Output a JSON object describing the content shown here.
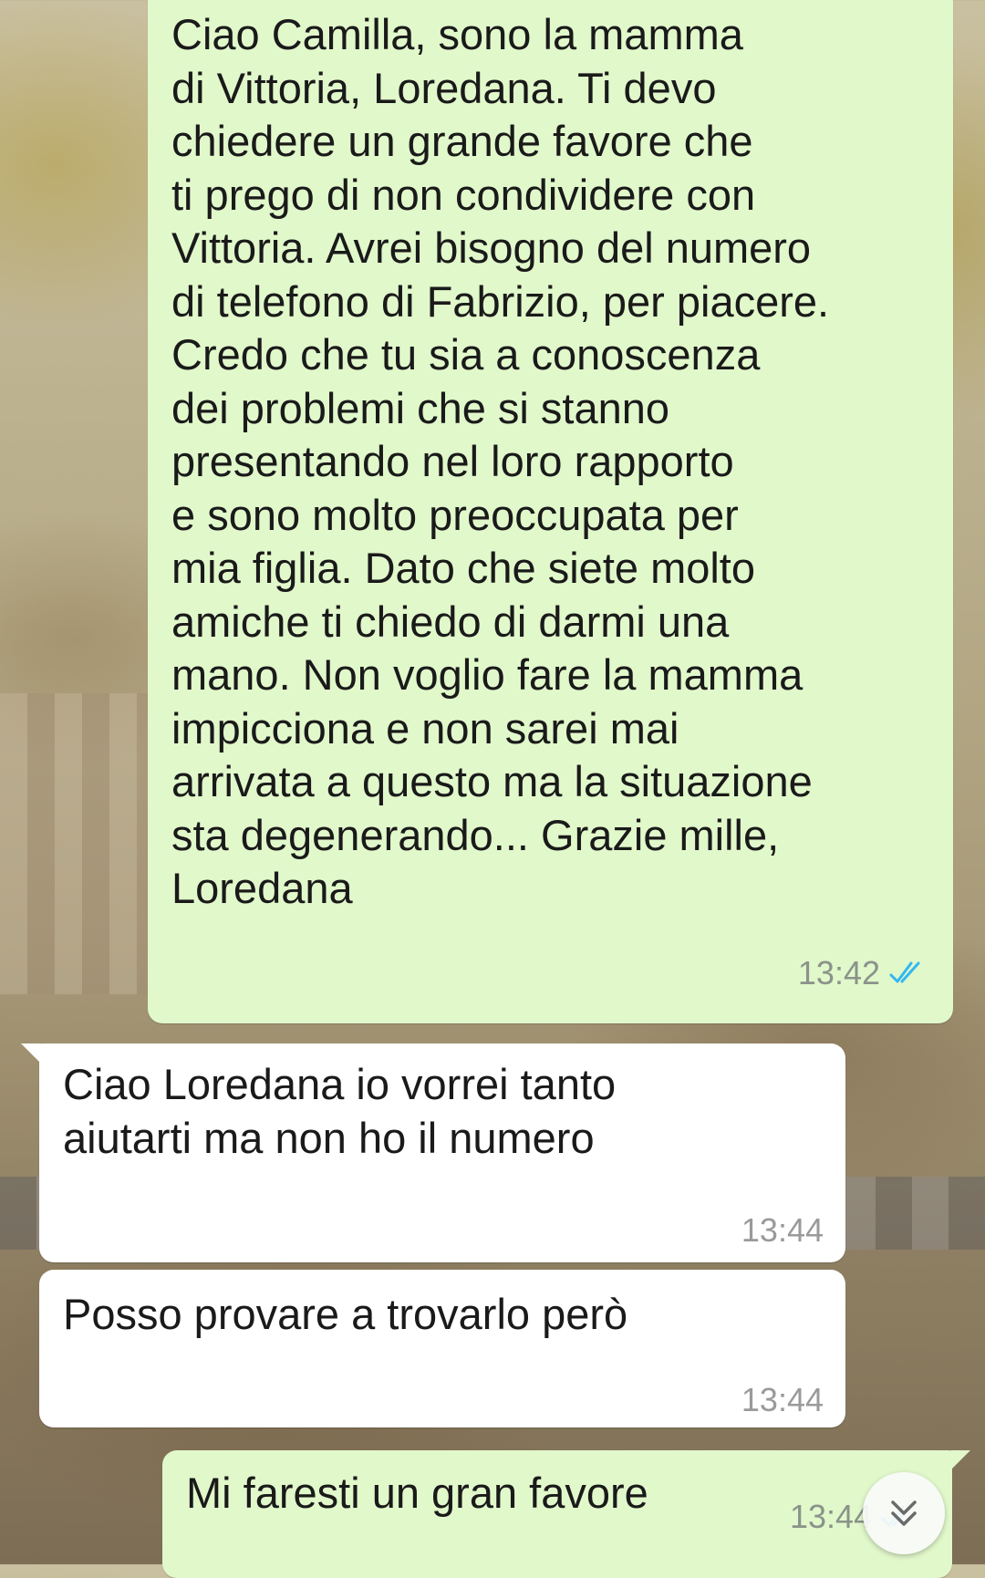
{
  "messages": [
    {
      "id": "m1",
      "direction": "outgoing",
      "text": "Ciao Camilla, sono la mamma\ndi Vittoria, Loredana. Ti devo\nchiedere un grande favore che\nti prego di non condividere con\nVittoria. Avrei bisogno del numero\ndi telefono di Fabrizio, per piacere.\nCredo che tu sia a conoscenza\ndei problemi che si stanno\npresentando nel loro rapporto\ne sono molto preoccupata per\nmia figlia. Dato che siete molto\namiche ti chiedo di darmi una\nmano. Non voglio fare la mamma\nimpicciona e non sarei mai\narrivata a questo ma la situazione\nsta degenerando... Grazie mille,\nLoredana",
      "time": "13:42",
      "status": "read",
      "status_icon": "double-check-icon",
      "status_color": "#34b7f1"
    },
    {
      "id": "m2",
      "direction": "incoming",
      "text": "Ciao Loredana io vorrei tanto\naiutarti ma non ho il numero",
      "time": "13:44"
    },
    {
      "id": "m3",
      "direction": "incoming",
      "text": "Posso provare a trovarlo però",
      "time": "13:44"
    },
    {
      "id": "m4",
      "direction": "outgoing",
      "text": "Mi faresti un gran favore",
      "time": "13:44",
      "status": "read",
      "status_icon": "double-check-icon",
      "status_color": "#34b7f1"
    }
  ],
  "scroll_button": {
    "icon": "double-chevron-down-icon"
  },
  "colors": {
    "outgoing_bubble": "#e1f8cb",
    "incoming_bubble": "#ffffff",
    "read_tick": "#34b7f1"
  }
}
